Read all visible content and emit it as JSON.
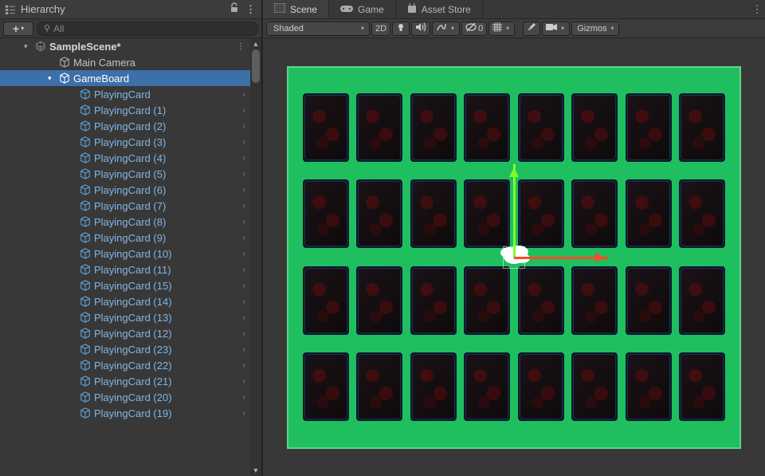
{
  "hierarchy": {
    "panel_title": "Hierarchy",
    "search_placeholder": "All",
    "scene": {
      "name": "SampleScene*",
      "children": [
        {
          "name": "Main Camera",
          "prefab": false
        },
        {
          "name": "GameBoard",
          "prefab": false,
          "selected": true,
          "expanded": true,
          "children": [
            {
              "name": "PlayingCard"
            },
            {
              "name": "PlayingCard (1)"
            },
            {
              "name": "PlayingCard (2)"
            },
            {
              "name": "PlayingCard (3)"
            },
            {
              "name": "PlayingCard (4)"
            },
            {
              "name": "PlayingCard (5)"
            },
            {
              "name": "PlayingCard (6)"
            },
            {
              "name": "PlayingCard (7)"
            },
            {
              "name": "PlayingCard (8)"
            },
            {
              "name": "PlayingCard (9)"
            },
            {
              "name": "PlayingCard (10)"
            },
            {
              "name": "PlayingCard (11)"
            },
            {
              "name": "PlayingCard (15)"
            },
            {
              "name": "PlayingCard (14)"
            },
            {
              "name": "PlayingCard (13)"
            },
            {
              "name": "PlayingCard (12)"
            },
            {
              "name": "PlayingCard (23)"
            },
            {
              "name": "PlayingCard (22)"
            },
            {
              "name": "PlayingCard (21)"
            },
            {
              "name": "PlayingCard (20)"
            },
            {
              "name": "PlayingCard (19)"
            }
          ]
        }
      ]
    }
  },
  "scene_view": {
    "tabs": [
      {
        "label": "Scene",
        "icon": "scene-icon",
        "active": true
      },
      {
        "label": "Game",
        "icon": "gamepad-icon"
      },
      {
        "label": "Asset Store",
        "icon": "bag-icon"
      }
    ],
    "toolbar": {
      "shading_mode": "Shaded",
      "mode_2d": "2D",
      "visibility_count": "0",
      "gizmos_label": "Gizmos"
    },
    "grid": {
      "rows": 4,
      "cols": 8
    }
  },
  "icons": {
    "add": "+",
    "dropdown": "▾",
    "kebab": "⋮",
    "lock": "◉",
    "search": "⚲",
    "chevron": "›",
    "arrow_down": "▼",
    "arrow_up": "▲",
    "light": "☀",
    "sound": "🔊",
    "fx": "✶",
    "eye": "⊘",
    "grid": "▦",
    "tool": "✖",
    "cam": "■"
  }
}
